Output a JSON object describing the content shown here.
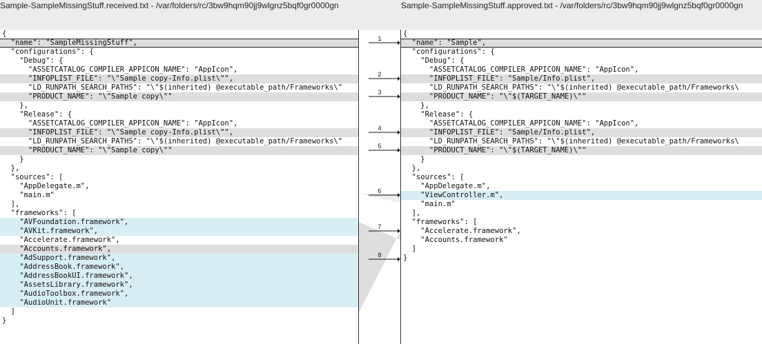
{
  "window": {
    "left_title": "Sample-SampleMissingStuff.received.txt - /var/folders/rc/3bw9hqm90jj9wlgnz5bqf0gr0000gn",
    "right_title": "Sample-SampleMissingStuff.approved.txt - /var/folders/rc/3bw9hqm90jj9wlgnz5bqf0gr0000gn"
  },
  "colors": {
    "changed": "#dedede",
    "inserted": "#d7eef4",
    "divider": "#333333"
  },
  "left_pane": {
    "lines": [
      {
        "text": "{",
        "hl": ""
      },
      {
        "text": "  \"name\": \"SampleMissingStuff\",",
        "hl": "gray box"
      },
      {
        "text": "  \"configurations\": {",
        "hl": ""
      },
      {
        "text": "    \"Debug\": {",
        "hl": ""
      },
      {
        "text": "      \"ASSETCATALOG_COMPILER_APPICON_NAME\": \"AppIcon\",",
        "hl": ""
      },
      {
        "text": "      \"INFOPLIST_FILE\": \"\\\"Sample copy-Info.plist\\\"\",",
        "hl": "gray"
      },
      {
        "text": "      \"LD_RUNPATH_SEARCH_PATHS\": \"\\\"$(inherited) @executable_path/Frameworks\\\"",
        "hl": ""
      },
      {
        "text": "      \"PRODUCT_NAME\": \"\\\"Sample copy\\\"\"",
        "hl": "gray"
      },
      {
        "text": "    },",
        "hl": ""
      },
      {
        "text": "    \"Release\": {",
        "hl": ""
      },
      {
        "text": "      \"ASSETCATALOG_COMPILER_APPICON_NAME\": \"AppIcon\",",
        "hl": ""
      },
      {
        "text": "      \"INFOPLIST_FILE\": \"\\\"Sample copy-Info.plist\\\"\",",
        "hl": "gray"
      },
      {
        "text": "      \"LD_RUNPATH_SEARCH_PATHS\": \"\\\"$(inherited) @executable_path/Frameworks\\\"",
        "hl": ""
      },
      {
        "text": "      \"PRODUCT_NAME\": \"\\\"Sample copy\\\"\"",
        "hl": "gray"
      },
      {
        "text": "    }",
        "hl": ""
      },
      {
        "text": "  },",
        "hl": ""
      },
      {
        "text": "  \"sources\": [",
        "hl": ""
      },
      {
        "text": "    \"AppDelegate.m\",",
        "hl": ""
      },
      {
        "text": "    \"main.m\"",
        "hl": ""
      },
      {
        "text": "  ],",
        "hl": ""
      },
      {
        "text": "  \"frameworks\": [",
        "hl": ""
      },
      {
        "text": "    \"AVFoundation.framework\",",
        "hl": "blue"
      },
      {
        "text": "    \"AVKit.framework\",",
        "hl": "blue"
      },
      {
        "text": "    \"Accelerate.framework\",",
        "hl": ""
      },
      {
        "text": "    \"Accounts.framework\",",
        "hl": "gray"
      },
      {
        "text": "    \"AdSupport.framework\",",
        "hl": "blue"
      },
      {
        "text": "    \"AddressBook.framework\",",
        "hl": "blue"
      },
      {
        "text": "    \"AddressBookUI.framework\",",
        "hl": "blue"
      },
      {
        "text": "    \"AssetsLibrary.framework\",",
        "hl": "blue"
      },
      {
        "text": "    \"AudioToolbox.framework\",",
        "hl": "blue"
      },
      {
        "text": "    \"AudioUnit.framework\"",
        "hl": "blue"
      },
      {
        "text": "  ]",
        "hl": ""
      },
      {
        "text": "}",
        "hl": ""
      }
    ]
  },
  "right_pane": {
    "lines": [
      {
        "text": "{",
        "hl": ""
      },
      {
        "text": "  \"name\": \"Sample\",",
        "hl": "gray box"
      },
      {
        "text": "  \"configurations\": {",
        "hl": ""
      },
      {
        "text": "    \"Debug\": {",
        "hl": ""
      },
      {
        "text": "      \"ASSETCATALOG_COMPILER_APPICON_NAME\": \"AppIcon\",",
        "hl": ""
      },
      {
        "text": "      \"INFOPLIST_FILE\": \"Sample/Info.plist\",",
        "hl": "gray"
      },
      {
        "text": "      \"LD_RUNPATH_SEARCH_PATHS\": \"\\\"$(inherited) @executable_path/Frameworks\\",
        "hl": ""
      },
      {
        "text": "      \"PRODUCT_NAME\": \"\\\"$(TARGET_NAME)\\\"\"",
        "hl": "gray"
      },
      {
        "text": "    },",
        "hl": ""
      },
      {
        "text": "    \"Release\": {",
        "hl": ""
      },
      {
        "text": "      \"ASSETCATALOG_COMPILER_APPICON_NAME\": \"AppIcon\",",
        "hl": ""
      },
      {
        "text": "      \"INFOPLIST_FILE\": \"Sample/Info.plist\",",
        "hl": "gray"
      },
      {
        "text": "      \"LD_RUNPATH_SEARCH_PATHS\": \"\\\"$(inherited) @executable_path/Frameworks\\",
        "hl": ""
      },
      {
        "text": "      \"PRODUCT_NAME\": \"\\\"$(TARGET_NAME)\\\"\"",
        "hl": "gray"
      },
      {
        "text": "    }",
        "hl": ""
      },
      {
        "text": "  },",
        "hl": ""
      },
      {
        "text": "  \"sources\": [",
        "hl": ""
      },
      {
        "text": "    \"AppDelegate.m\",",
        "hl": ""
      },
      {
        "text": "    \"ViewController.m\",",
        "hl": "blue"
      },
      {
        "text": "    \"main.m\"",
        "hl": ""
      },
      {
        "text": "  ],",
        "hl": ""
      },
      {
        "text": "  \"frameworks\": [",
        "hl": ""
      },
      {
        "text": "    \"Accelerate.framework\",",
        "hl": ""
      },
      {
        "text": "    \"Accounts.framework\"",
        "hl": ""
      },
      {
        "text": "  ]",
        "hl": ""
      },
      {
        "text": "}",
        "hl": ""
      }
    ]
  },
  "diff_markers": [
    "1",
    "2",
    "3",
    "4",
    "5",
    "6",
    "7",
    "8"
  ]
}
